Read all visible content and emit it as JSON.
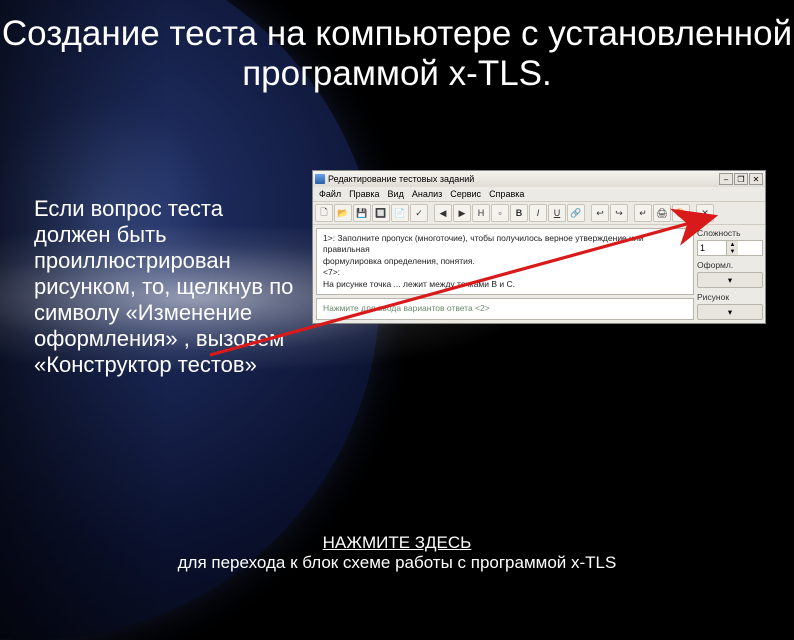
{
  "title": "Создание теста на компьютере с установленной программой x-TLS.",
  "body": "Если вопрос теста должен быть проиллюстрирован рисунком, то, щелкнув по символу «Изменение оформления» , вызовем «Конструктор тестов»",
  "footer": {
    "link": "НАЖМИТЕ ЗДЕСЬ",
    "text": "для перехода к блок схеме работы с программой x-TLS"
  },
  "editor": {
    "title": "Редактирование тестовых заданий",
    "menu": [
      "Файл",
      "Правка",
      "Вид",
      "Анализ",
      "Сервис",
      "Справка"
    ],
    "toolbar_glyphs": [
      "🗋",
      "📂",
      "💾",
      "🔲",
      "📄",
      "✓",
      "|",
      "◀",
      "▶",
      "H",
      "▫",
      "B",
      "I",
      "U",
      "🔗",
      "|",
      "↩",
      "↪",
      "|",
      "↵",
      "🖨",
      "🎨",
      "|",
      "✕"
    ],
    "panel1_line1": "1>: Заполните пропуск (многоточие), чтобы получилось верное утверждение или правильная",
    "panel1_line2": "формулировка определения, понятия.",
    "panel1_line3": "<7>:",
    "panel1_line4": "На рисунке точка ... лежит между точками B и C.",
    "panel2_hint": "Нажмите для ввода вариантов ответа <2>",
    "side": {
      "label1": "Сложность",
      "value1": "1",
      "label2": "Оформл.",
      "label3": "Рисунок"
    }
  }
}
